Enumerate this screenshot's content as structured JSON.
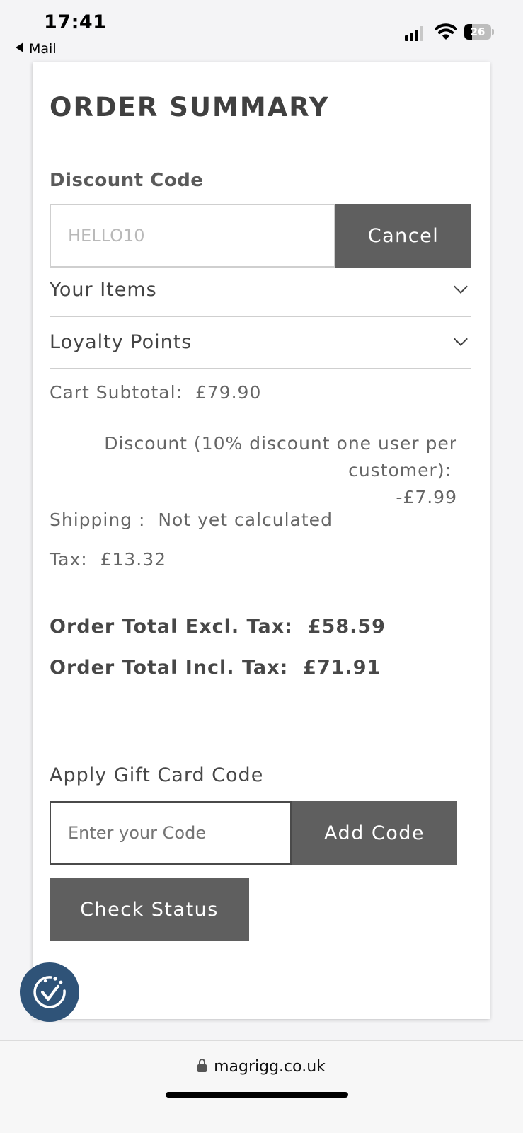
{
  "status_bar": {
    "time": "17:41",
    "back_app": "Mail",
    "battery": "26"
  },
  "order_summary": {
    "title": "ORDER SUMMARY",
    "discount_label": "Discount Code",
    "discount_value": "HELLO10",
    "cancel_label": "Cancel",
    "sections": [
      {
        "label": "Your Items",
        "icon": "chevron-down-icon"
      },
      {
        "label": "Loyalty Points",
        "icon": "chevron-down-icon"
      }
    ],
    "cart_subtotal_label": "Cart Subtotal:",
    "cart_subtotal_value": "£79.90",
    "discount_line1": "Discount (10% discount one user per",
    "discount_line2": "customer):",
    "discount_amount": "-£7.99",
    "shipping_label": "Shipping :",
    "shipping_value": "Not yet calculated",
    "tax_label": "Tax:",
    "tax_value": "£13.32",
    "total_excl_label": "Order Total Excl. Tax:",
    "total_excl_value": "£58.59",
    "total_incl_label": "Order Total Incl. Tax:",
    "total_incl_value": "£71.91",
    "gift_label": "Apply Gift Card Code",
    "gift_placeholder": "Enter your Code",
    "add_code_label": "Add Code",
    "check_status_label": "Check Status"
  },
  "browser": {
    "url": "magrigg.co.uk"
  },
  "colors": {
    "button": "#5f5f5f",
    "badge": "#2f5378"
  }
}
